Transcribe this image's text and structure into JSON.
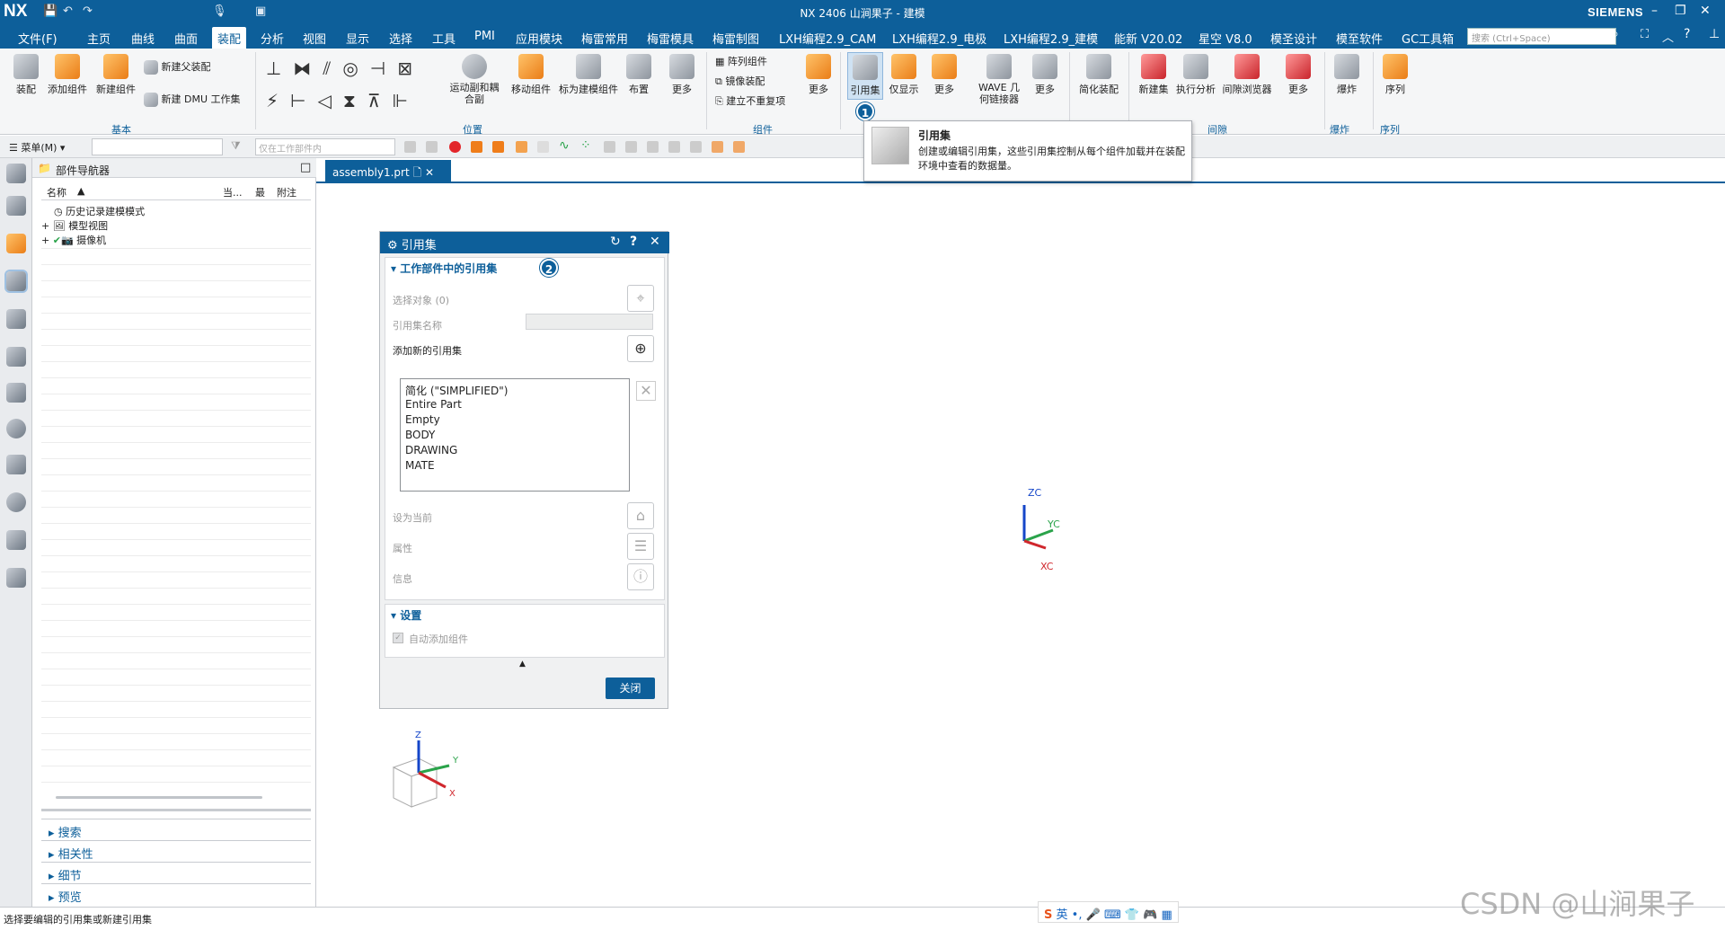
{
  "app": {
    "logo": "NX",
    "window_title": "NX 2406 山涧果子 - 建模",
    "brand": "SIEMENS",
    "window_controls": [
      "–",
      "❐",
      "✕"
    ]
  },
  "menu": {
    "file": "文件(F)",
    "tabs": [
      "主页",
      "曲线",
      "曲面",
      "装配",
      "分析",
      "视图",
      "显示",
      "选择",
      "工具",
      "PMI",
      "应用模块",
      "梅雷常用",
      "梅雷模具",
      "梅雷制图",
      "LXH编程2.9_CAM",
      "LXH编程2.9_电极",
      "LXH编程2.9_建模",
      "能新 V20.02",
      "星空 V8.0",
      "模圣设计",
      "模至软件",
      "GC工具箱"
    ],
    "active_tab": "装配",
    "search_placeholder": "搜索 (Ctrl+Space)"
  },
  "ribbon": {
    "basic": {
      "group": "基本",
      "assemble": "装配",
      "add_component": "添加组件",
      "new_component": "新建组件",
      "new_parent": "新建父装配",
      "new_dmu": "新建 DMU 工作集"
    },
    "position": {
      "group": "位置",
      "motion_couple": "运动副和耦合副",
      "move_component": "移动组件",
      "mark_as_model": "标为建模组件",
      "layout": "布置",
      "more": "更多"
    },
    "component": {
      "group": "组件",
      "pattern": "阵列组件",
      "mirror": "镜像装配",
      "no_repeat": "建立不重复项",
      "more": "更多"
    },
    "display": {
      "reference_set": "引用集",
      "only_show": "仅显示",
      "more": "更多",
      "wave": "WAVE 几何链接器",
      "more2": "更多"
    },
    "simplify": {
      "label": "简化装配"
    },
    "clearance": {
      "group": "间隙",
      "new_set": "新建集",
      "run_analysis": "执行分析",
      "browser": "间隙浏览器",
      "more": "更多"
    },
    "explode": {
      "group": "爆炸",
      "label": "爆炸"
    },
    "sequence": {
      "group": "序列",
      "label": "序列"
    }
  },
  "toolbar2": {
    "menu": "菜单(M)",
    "filter_placeholder": "仅在工作部件内"
  },
  "navigator": {
    "title": "部件导航器",
    "columns": [
      "名称",
      "当...",
      "最",
      "附注"
    ],
    "rows": [
      "历史记录建模模式",
      "模型视图",
      "摄像机"
    ],
    "sections": [
      "搜索",
      "相关性",
      "细节",
      "预览"
    ]
  },
  "document_tab": "assembly1.prt",
  "tooltip": {
    "title": "引用集",
    "text": "创建或编辑引用集，这些引用集控制从每个组件加载并在装配环境中查看的数据量。"
  },
  "dialog": {
    "title": "引用集",
    "section1": "工作部件中的引用集",
    "select_object": "选择对象 (0)",
    "ref_set_name": "引用集名称",
    "add_new": "添加新的引用集",
    "list": [
      "简化 (\"SIMPLIFIED\")",
      "Entire Part",
      "Empty",
      "BODY",
      "DRAWING",
      "MATE"
    ],
    "set_current": "设为当前",
    "properties": "属性",
    "info": "信息",
    "section2": "设置",
    "auto_add": "自动添加组件",
    "close": "关闭"
  },
  "axes": {
    "zc": "ZC",
    "yc": "YC",
    "xc": "XC",
    "z": "Z",
    "y": "Y",
    "x": "X"
  },
  "badges": {
    "one": "1",
    "two": "2"
  },
  "status": "选择要编辑的引用集或新建引用集",
  "ime": "英",
  "watermark": "CSDN @山涧果子",
  "colors": {
    "accent": "#0d5f9a",
    "axis_z": "#1546c9",
    "axis_y": "#2aa34a",
    "axis_x": "#d0272d"
  }
}
